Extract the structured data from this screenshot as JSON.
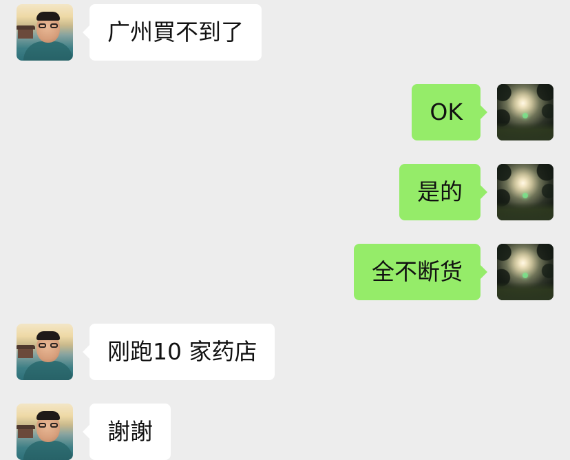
{
  "messages": [
    {
      "side": "left",
      "text": "广州買不到了",
      "avatar": "contact-avatar"
    },
    {
      "side": "right",
      "text": "OK",
      "avatar": "own-avatar"
    },
    {
      "side": "right",
      "text": "是的",
      "avatar": "own-avatar"
    },
    {
      "side": "right",
      "text": "全不断货",
      "avatar": "own-avatar"
    },
    {
      "side": "left",
      "text": "刚跑10 家药店",
      "avatar": "contact-avatar"
    },
    {
      "side": "left",
      "text": "謝謝",
      "avatar": "contact-avatar"
    }
  ],
  "colors": {
    "background": "#ededed",
    "incoming_bubble": "#ffffff",
    "outgoing_bubble": "#95ec69",
    "text": "#111111"
  }
}
